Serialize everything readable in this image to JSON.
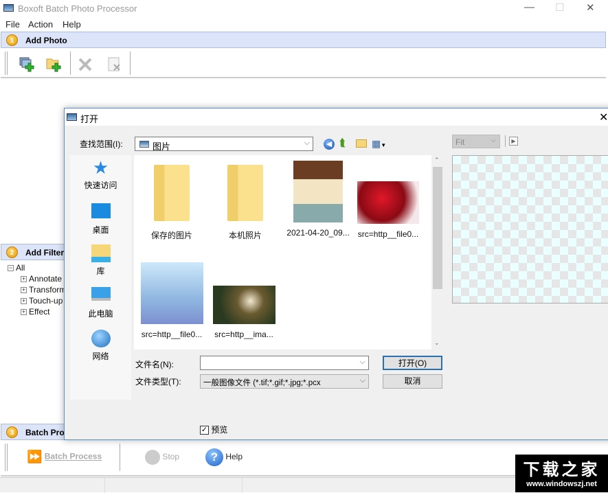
{
  "app": {
    "title": "Boxoft Batch Photo Processor",
    "menu": [
      "File",
      "Action",
      "Help"
    ]
  },
  "sections": {
    "add_photo": {
      "num": "1",
      "label": "Add Photo"
    },
    "add_filter": {
      "num": "2",
      "label": "Add Filter"
    },
    "batch": {
      "num": "3",
      "label": "Batch Process"
    }
  },
  "filter_tree": {
    "root": "All",
    "children": [
      "Annotate",
      "Transform",
      "Touch-up",
      "Effect"
    ]
  },
  "bottom_toolbar": {
    "batch": "Batch Process",
    "stop": "Stop",
    "help": "Help"
  },
  "dialog": {
    "title": "打开",
    "look_in_label": "查找范围(I):",
    "look_in_value": "图片",
    "places": [
      "快速访问",
      "桌面",
      "库",
      "此电脑",
      "网络"
    ],
    "files": [
      {
        "name": "保存的图片",
        "type": "folder"
      },
      {
        "name": "本机照片",
        "type": "folder"
      },
      {
        "name": "2021-04-20_09...",
        "type": "image"
      },
      {
        "name": "src=http__file0...",
        "type": "image"
      },
      {
        "name": "src=http__file0...",
        "type": "image"
      },
      {
        "name": "src=http__ima...",
        "type": "image"
      }
    ],
    "filename_label": "文件名(N):",
    "filename_value": "",
    "filetype_label": "文件类型(T):",
    "filetype_value": "一般图像文件 (*.tif;*.gif;*.jpg;*.pcx",
    "open_button": "打开(O)",
    "cancel_button": "取消",
    "preview_label": "预览",
    "preview_checked": true,
    "zoom_value": "Fit"
  },
  "watermark": {
    "line1": "下载之家",
    "line2": "www.windowszj.net"
  }
}
